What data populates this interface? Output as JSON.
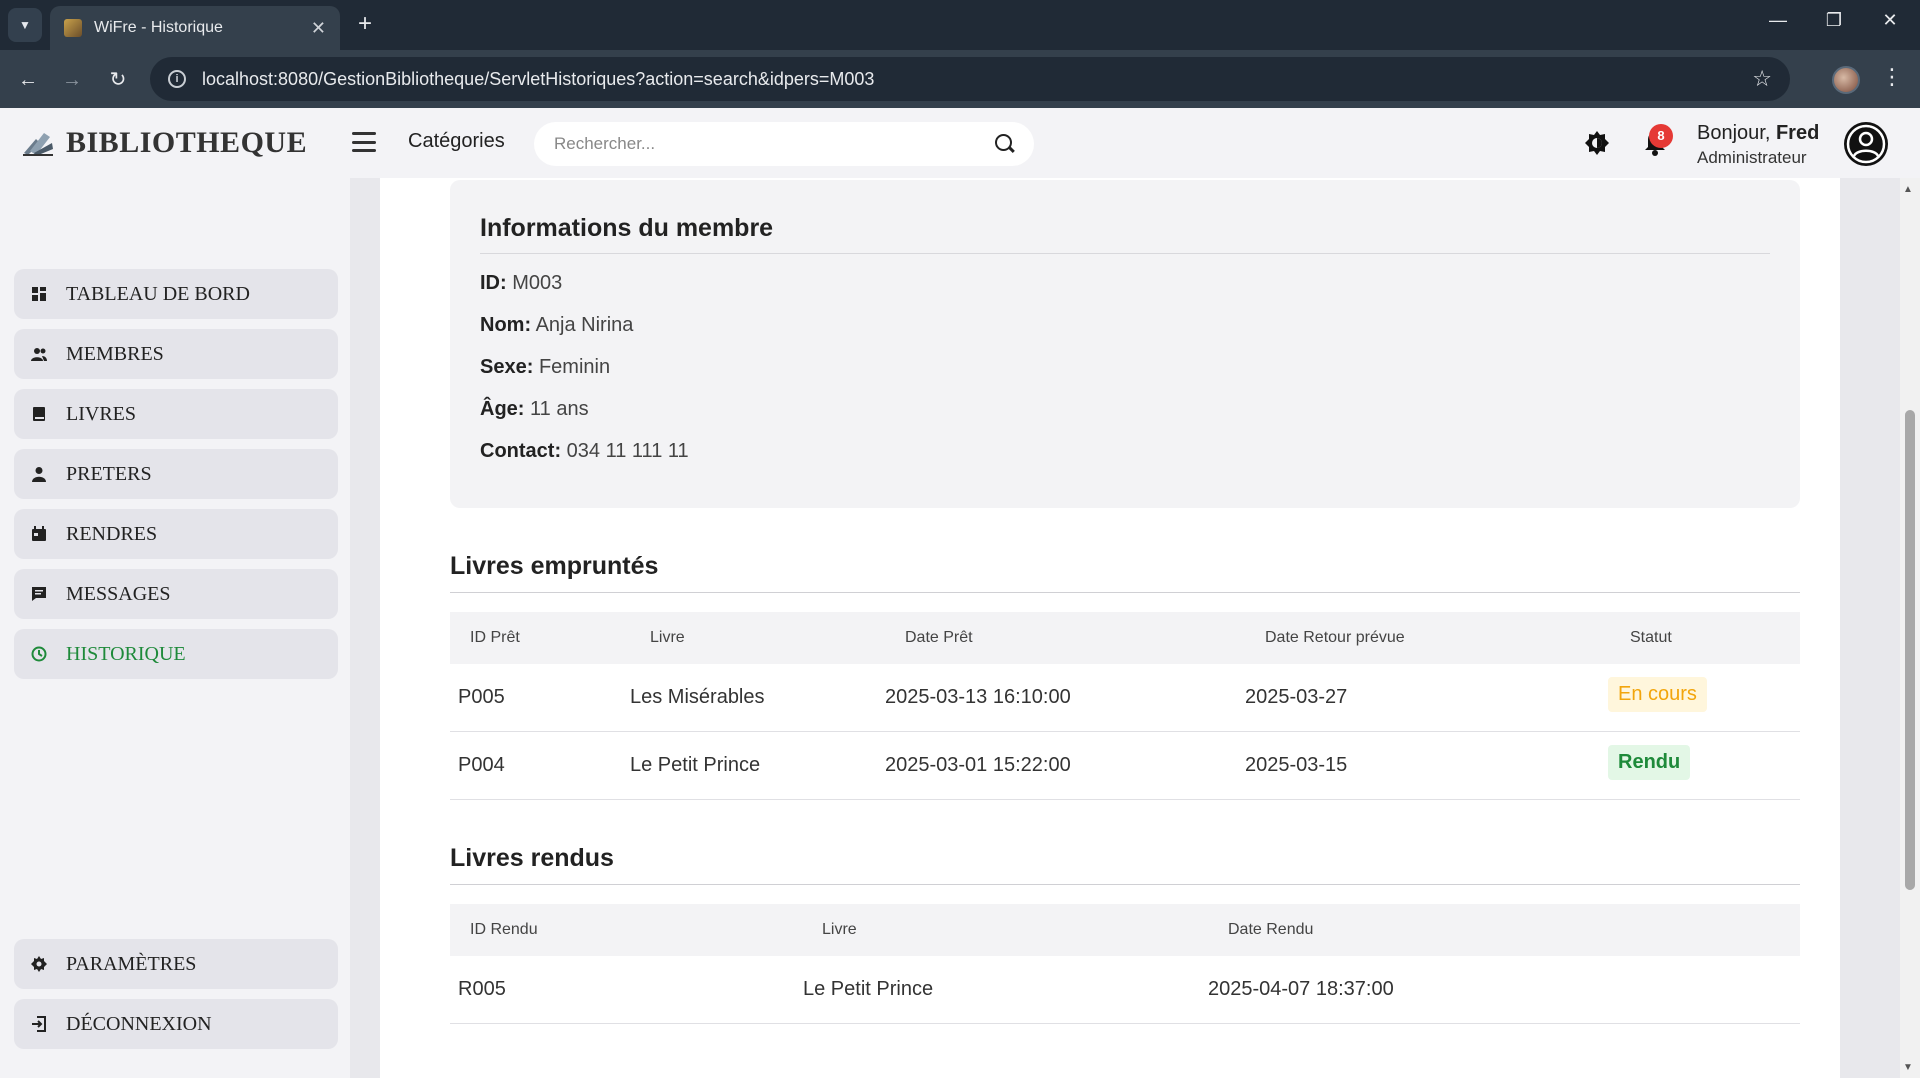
{
  "browser": {
    "tab_title": "WiFre - Historique",
    "url": "localhost:8080/GestionBibliotheque/ServletHistoriques?action=search&idpers=M003"
  },
  "header": {
    "logo_text": "BIBLIOTHEQUE",
    "categories_label": "Catégories",
    "search_placeholder": "Rechercher...",
    "notification_count": "8",
    "greeting_prefix": "Bonjour,",
    "user_name": "Fred",
    "user_role": "Administrateur"
  },
  "sidebar": {
    "items": [
      {
        "label": "TABLEAU DE BORD",
        "icon": "dashboard-icon"
      },
      {
        "label": "MEMBRES",
        "icon": "members-icon"
      },
      {
        "label": "LIVRES",
        "icon": "book-icon"
      },
      {
        "label": "PRETERS",
        "icon": "user-icon"
      },
      {
        "label": "RENDRES",
        "icon": "calendar-icon"
      },
      {
        "label": "MESSAGES",
        "icon": "message-icon"
      },
      {
        "label": "HISTORIQUE",
        "icon": "history-icon",
        "active": true
      }
    ],
    "bottom_items": [
      {
        "label": "PARAMÈTRES",
        "icon": "gear-icon"
      },
      {
        "label": "DÉCONNEXION",
        "icon": "logout-icon"
      }
    ],
    "active_color": "#1e8a3a"
  },
  "member": {
    "title": "Informations du membre",
    "fields": [
      {
        "label": "ID:",
        "value": "M003"
      },
      {
        "label": "Nom:",
        "value": "Anja Nirina"
      },
      {
        "label": "Sexe:",
        "value": "Feminin"
      },
      {
        "label": "Âge:",
        "value": "11 ans"
      },
      {
        "label": "Contact:",
        "value": "034 11 111 11"
      }
    ]
  },
  "borrowed": {
    "title": "Livres empruntés",
    "columns": [
      "ID Prêt",
      "Livre",
      "Date Prêt",
      "Date Retour prévue",
      "Statut"
    ],
    "rows": [
      {
        "id": "P005",
        "livre": "Les Misérables",
        "date_pret": "2025-03-13 16:10:00",
        "date_retour": "2025-03-27",
        "statut": "En cours"
      },
      {
        "id": "P004",
        "livre": "Le Petit Prince",
        "date_pret": "2025-03-01 15:22:00",
        "date_retour": "2025-03-15",
        "statut": "Rendu"
      }
    ]
  },
  "returned": {
    "title": "Livres rendus",
    "columns": [
      "ID Rendu",
      "Livre",
      "Date Rendu"
    ],
    "rows": [
      {
        "id": "R005",
        "livre": "Le Petit Prince",
        "date_rendu": "2025-04-07 18:37:00"
      }
    ]
  }
}
